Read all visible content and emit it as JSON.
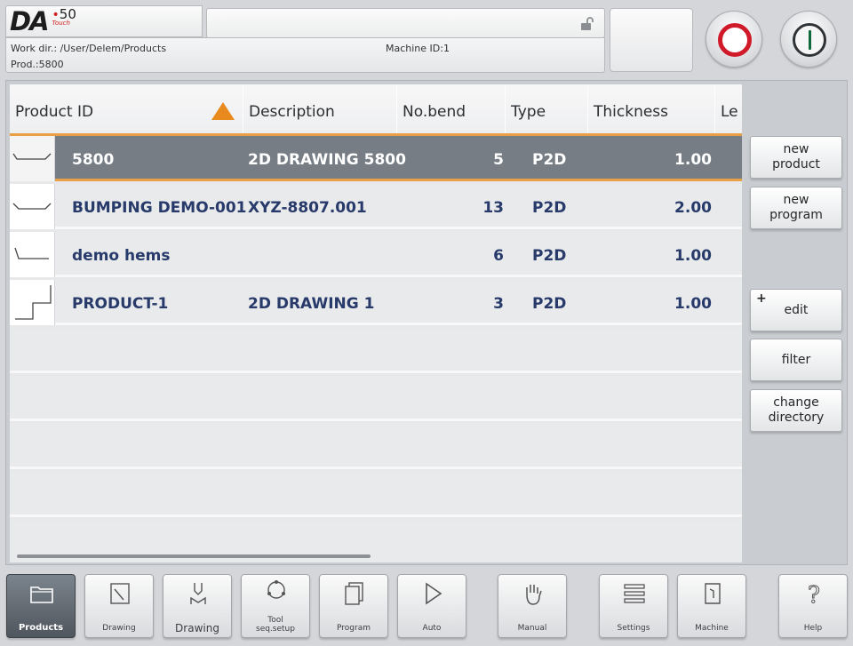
{
  "header": {
    "logo_text": "DA",
    "model_number": "50",
    "model_sub": "Touch",
    "work_dir": "Work dir.: /User/Delem/Products",
    "prod": "Prod.:5800",
    "machine_id": "Machine ID:1"
  },
  "table": {
    "columns": [
      "Product ID",
      "Description",
      "No.bend",
      "Type",
      "Thickness",
      "Le"
    ],
    "rows": [
      {
        "id": "5800",
        "description": "2D DRAWING 5800",
        "bends": "5",
        "type": "P2D",
        "thickness": "1.00"
      },
      {
        "id": "BUMPING DEMO-001",
        "description": "XYZ-8807.001",
        "bends": "13",
        "type": "P2D",
        "thickness": "2.00"
      },
      {
        "id": "demo hems",
        "description": "",
        "bends": "6",
        "type": "P2D",
        "thickness": "1.00"
      },
      {
        "id": "PRODUCT-1",
        "description": "2D DRAWING 1",
        "bends": "3",
        "type": "P2D",
        "thickness": "1.00"
      }
    ]
  },
  "side_buttons": {
    "new_product": "new\nproduct",
    "new_program": "new\nprogram",
    "edit_plus": "+",
    "edit": "edit",
    "filter": "filter",
    "change_directory": "change\ndirectory"
  },
  "nav": {
    "products": "Products",
    "drawing_1": "Drawing",
    "drawing_2": "Drawing",
    "tool_setup": "Tool\nseq.setup",
    "program": "Program",
    "auto": "Auto",
    "manual": "Manual",
    "settings": "Settings",
    "machine": "Machine",
    "help": "Help"
  },
  "colors": {
    "selected_row": "#767d85",
    "accent_orange": "#e9a046",
    "stop_red": "#d01a2a",
    "text_blue": "#273a6a"
  }
}
